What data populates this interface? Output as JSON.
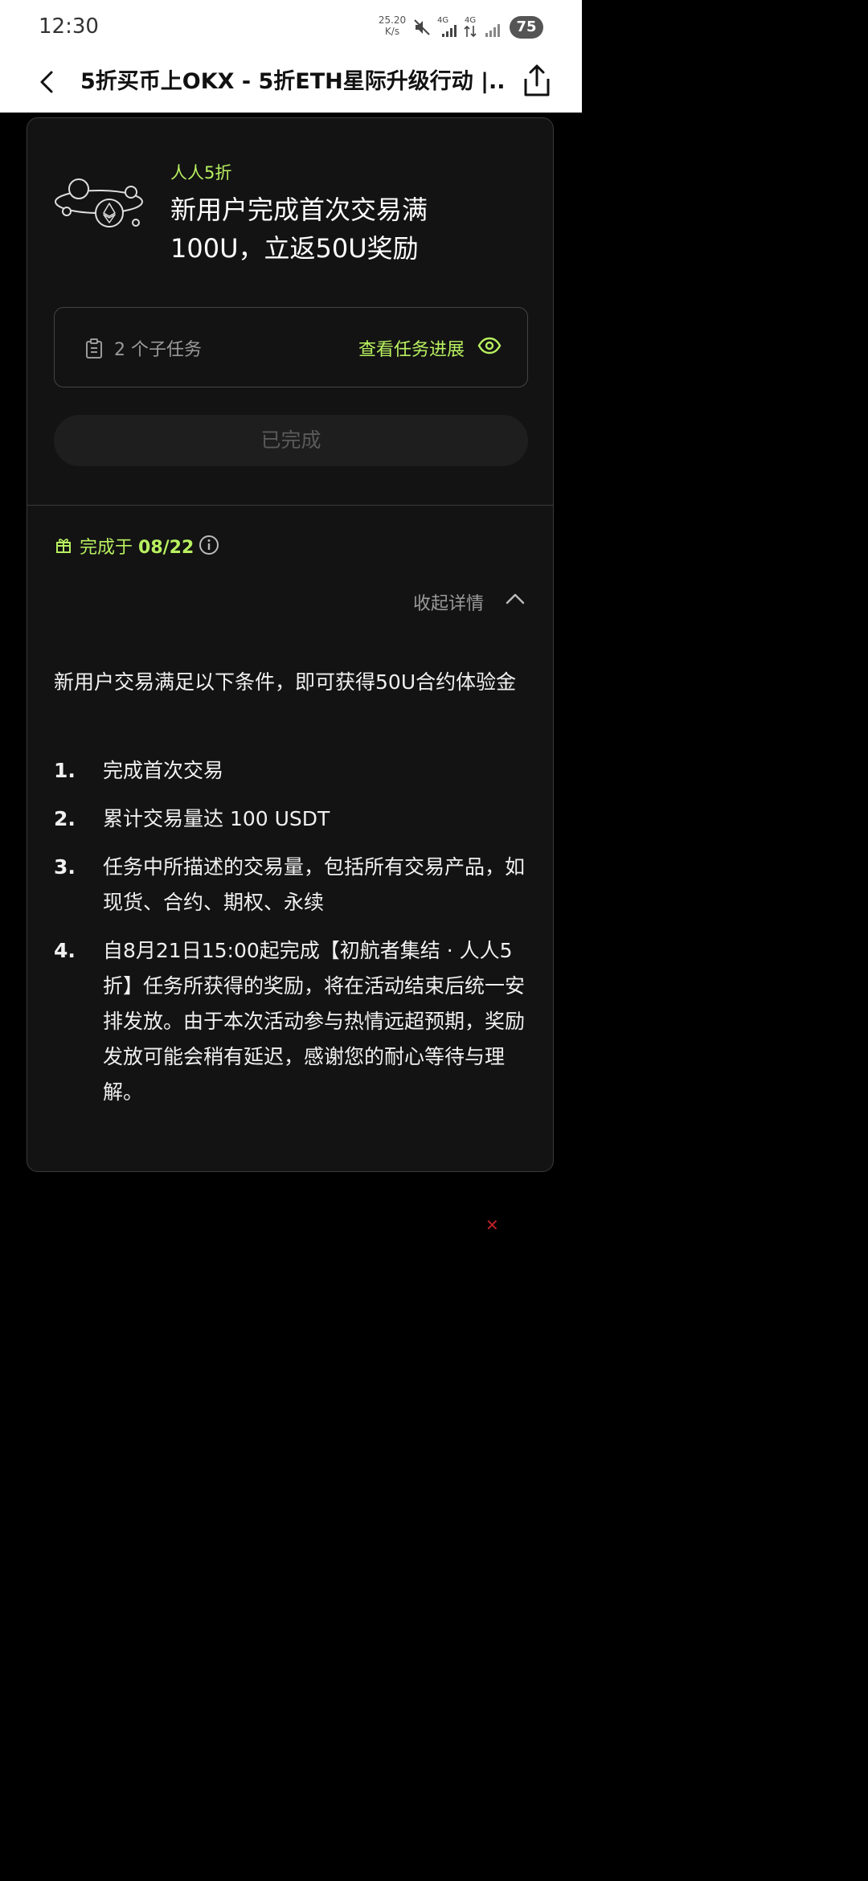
{
  "status_bar": {
    "time": "12:30",
    "net_speed_value": "25.20",
    "net_speed_unit": "K/s",
    "signal_1": "4G",
    "signal_2": "4G",
    "battery": "75"
  },
  "nav": {
    "title": "5折买币上OKX - 5折ETH星际升级行动 |..."
  },
  "task": {
    "tag": "人人5折",
    "headline": "新用户完成首次交易满100U，立返50U奖励",
    "subtasks": "2 个子任务",
    "view_progress": "查看任务进展",
    "status_button": "已完成",
    "completed_prefix": "完成于",
    "completed_date": "08/22",
    "collapse_label": "收起详情"
  },
  "details": {
    "intro": "新用户交易满足以下条件，即可获得50U合约体验金",
    "items": [
      {
        "num": "1.",
        "text": "完成首次交易"
      },
      {
        "num": "2.",
        "text": "累计交易量达 100 USDT"
      },
      {
        "num": "3.",
        "text": "任务中所描述的交易量，包括所有交易产品，如现货、合约、期权、永续"
      },
      {
        "num": "4.",
        "text": "自8月21日15:00起完成【初航者集结 · 人人5折】任务所获得的奖励，将在活动结束后统一安排发放。由于本次活动参与热情远超预期，奖励发放可能会稍有延迟，感谢您的耐心等待与理解。"
      }
    ]
  },
  "colors": {
    "accent": "#b8f060",
    "card_bg": "#131313",
    "page_bg": "#000000"
  },
  "icons": [
    "back-arrow-icon",
    "share-icon",
    "orbit-eth-icon",
    "clipboard-icon",
    "eye-icon",
    "gift-icon",
    "info-icon",
    "chevron-up-icon",
    "mute-icon",
    "signal-icon"
  ]
}
